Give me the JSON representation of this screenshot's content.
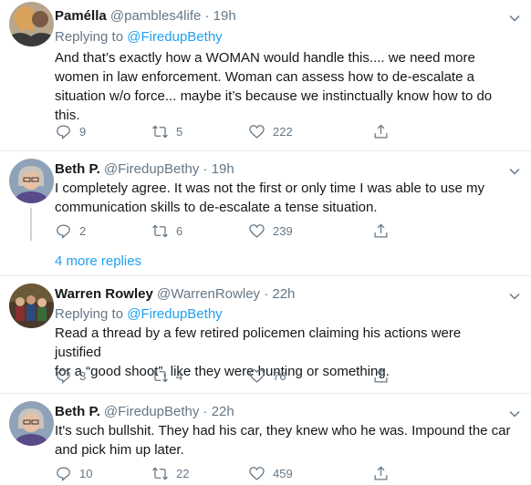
{
  "tweets": [
    {
      "name": "Pamélla",
      "handle": "@pambles4life",
      "time": "· 19h",
      "replying_prefix": "Replying to ",
      "replying_to": "@FiredupBethy",
      "lines": [
        "And that’s exactly how a WOMAN would handle this.... we need more",
        "women in law enforcement. Woman can assess how to de-escalate a",
        "situation w/o force... maybe it’s because we instinctually know how to do",
        "this."
      ],
      "replies": "9",
      "retweets": "5",
      "likes": "222"
    },
    {
      "name": "Beth P.",
      "handle": "@FiredupBethy",
      "time": "· 19h",
      "lines": [
        "I completely agree.  It was not the first or only time I was able to use my",
        "communication skills to de-escalate a tense situation."
      ],
      "replies": "2",
      "retweets": "6",
      "likes": "239"
    },
    {
      "name": "Warren Rowley",
      "handle": "@WarrenRowley",
      "time": "· 22h",
      "replying_prefix": "Replying to ",
      "replying_to": "@FiredupBethy",
      "lines": [
        "Read a thread by a few retired policemen claiming his actions were justified",
        "for a “good shoot”, like they were hunting or something."
      ],
      "replies": "3",
      "retweets": "4",
      "likes": "76"
    },
    {
      "name": "Beth P.",
      "handle": "@FiredupBethy",
      "time": "· 22h",
      "lines": [
        "It's such bullshit.  They had his car, they knew who he was.  Impound the car",
        "and pick him up later."
      ],
      "replies": "10",
      "retweets": "22",
      "likes": "459"
    }
  ],
  "more_replies": "4 more replies"
}
